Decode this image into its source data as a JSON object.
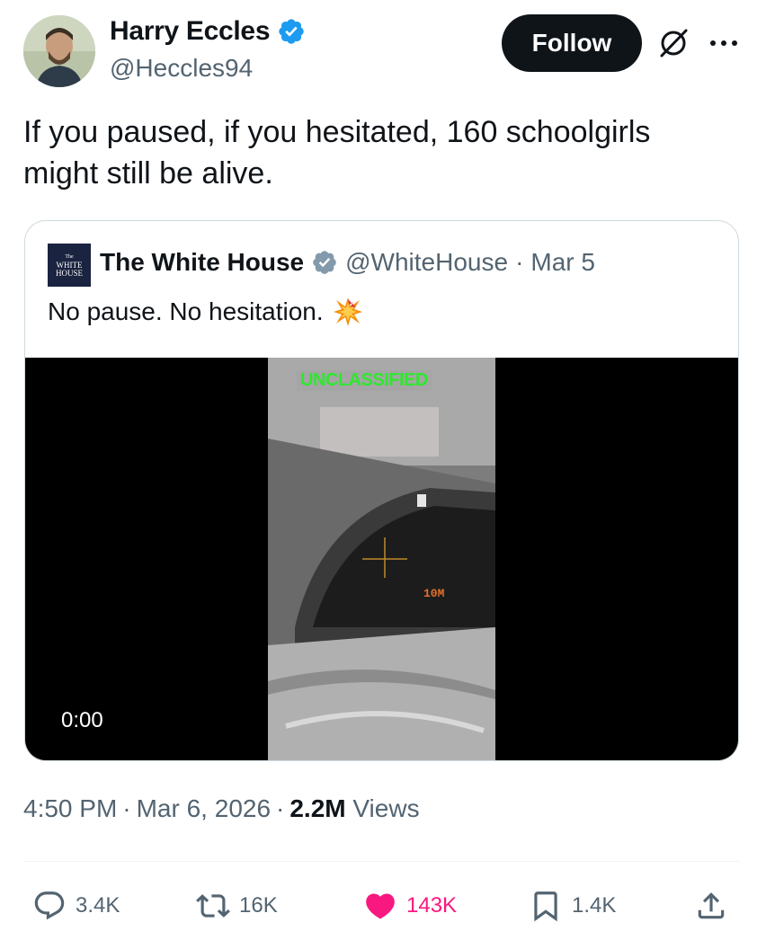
{
  "author": {
    "name": "Harry Eccles",
    "handle": "@Heccles94",
    "verified": true
  },
  "follow_label": "Follow",
  "tweet_text": "If you paused, if you hesitated, 160 schoolgirls might still be alive.",
  "quoted": {
    "avatar_text_top": "The",
    "avatar_text_line1": "WHITE",
    "avatar_text_line2": "HOUSE",
    "name": "The White House",
    "handle": "@WhiteHouse",
    "separator": "·",
    "date": "Mar 5",
    "text": "No pause. No hesitation.",
    "video": {
      "timestamp": "0:00",
      "overlay_label": "UNCLASSIFIED",
      "range_label": "10M"
    }
  },
  "meta": {
    "time": "4:50 PM",
    "dot1": "·",
    "date": "Mar 6, 2026",
    "dot2": "·",
    "views_count": "2.2M",
    "views_label": "Views"
  },
  "actions": {
    "replies": "3.4K",
    "reposts": "16K",
    "likes": "143K",
    "bookmarks": "1.4K"
  },
  "icons": {
    "verified": "verified-badge-icon",
    "grok": "grok-icon",
    "more": "more-icon",
    "reply": "reply-icon",
    "repost": "repost-icon",
    "like": "heart-icon",
    "bookmark": "bookmark-icon",
    "share": "share-icon"
  },
  "colors": {
    "verified_blue": "#1d9bf0",
    "like_pink": "#f91880",
    "secondary_text": "#536471",
    "primary_text": "#0f1419"
  }
}
